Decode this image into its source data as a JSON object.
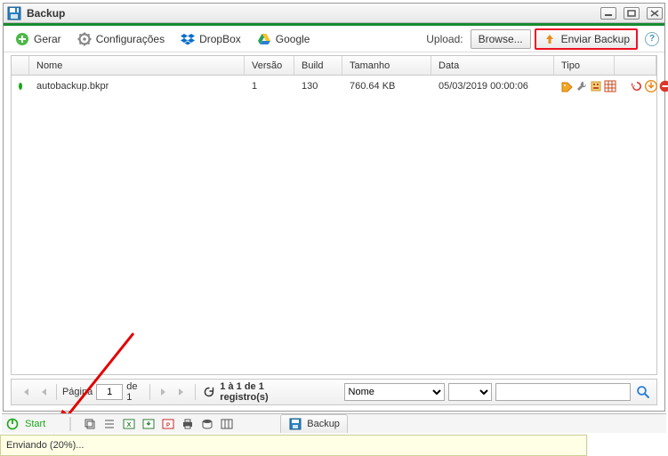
{
  "window": {
    "title": "Backup"
  },
  "toolbar": {
    "gerar": "Gerar",
    "config": "Configurações",
    "dropbox": "DropBox",
    "google": "Google",
    "upload_label": "Upload:",
    "browse": "Browse...",
    "enviar": "Enviar Backup"
  },
  "grid": {
    "headers": {
      "nome": "Nome",
      "versao": "Versão",
      "build": "Build",
      "tamanho": "Tamanho",
      "data": "Data",
      "tipo": "Tipo"
    },
    "rows": [
      {
        "nome": "autobackup.bkpr",
        "versao": "1",
        "build": "130",
        "tamanho": "760.64 KB",
        "data": "05/03/2019 00:00:06"
      }
    ]
  },
  "pager": {
    "label_pagina": "Página",
    "page": "1",
    "label_de": "de 1",
    "summary": "1 à 1 de 1 registro(s)",
    "filter_options": [
      "Nome"
    ],
    "filter_selected": "Nome"
  },
  "bottom": {
    "start": "Start",
    "backup_tab": "Backup"
  },
  "status": {
    "tooltip": "Enviando (20%)..."
  }
}
